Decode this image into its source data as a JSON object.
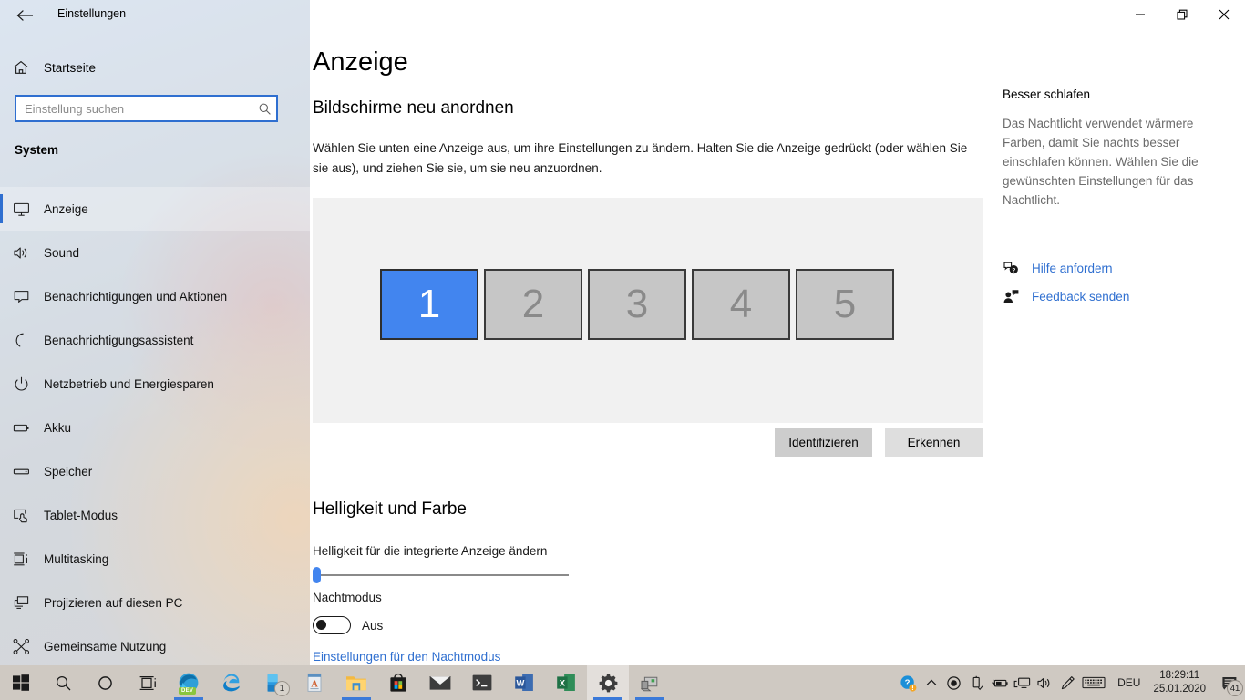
{
  "window": {
    "app_title": "Einstellungen",
    "back_icon": "back-arrow-icon",
    "minimize_label": "—",
    "maximize_label": "❐",
    "close_label": "✕"
  },
  "sidebar": {
    "home_label": "Startseite",
    "home_icon": "home-icon",
    "search": {
      "placeholder": "Einstellung suchen",
      "value": "",
      "icon": "search-icon"
    },
    "section_title": "System",
    "items": [
      {
        "label": "Anzeige",
        "icon": "monitor-icon",
        "selected": true
      },
      {
        "label": "Sound",
        "icon": "speaker-icon",
        "selected": false
      },
      {
        "label": "Benachrichtigungen und Aktionen",
        "icon": "chat-bubble-icon",
        "selected": false
      },
      {
        "label": "Benachrichtigungsassistent",
        "icon": "moon-icon",
        "selected": false
      },
      {
        "label": "Netzbetrieb und Energiesparen",
        "icon": "power-icon",
        "selected": false
      },
      {
        "label": "Akku",
        "icon": "battery-icon",
        "selected": false
      },
      {
        "label": "Speicher",
        "icon": "storage-icon",
        "selected": false
      },
      {
        "label": "Tablet-Modus",
        "icon": "tablet-hand-icon",
        "selected": false
      },
      {
        "label": "Multitasking",
        "icon": "multitasking-icon",
        "selected": false
      },
      {
        "label": "Projizieren auf diesen PC",
        "icon": "project-screen-icon",
        "selected": false
      },
      {
        "label": "Gemeinsame Nutzung",
        "icon": "share-icon",
        "selected": false
      }
    ]
  },
  "main": {
    "page_title": "Anzeige",
    "rearrange_heading": "Bildschirme neu anordnen",
    "rearrange_description": "Wählen Sie unten eine Anzeige aus, um ihre Einstellungen zu ändern. Halten Sie die Anzeige gedrückt (oder wählen Sie sie aus), und ziehen Sie sie, um sie neu anzuordnen.",
    "monitors": [
      {
        "number": "1",
        "selected": true
      },
      {
        "number": "2",
        "selected": false
      },
      {
        "number": "3",
        "selected": false
      },
      {
        "number": "4",
        "selected": false
      },
      {
        "number": "5",
        "selected": false
      }
    ],
    "identify_button": "Identifizieren",
    "detect_button": "Erkennen",
    "brightness_heading": "Helligkeit und Farbe",
    "brightness_label": "Helligkeit für die integrierte Anzeige ändern",
    "brightness_value": 0,
    "night_mode_label": "Nachtmodus",
    "night_mode_state": "Aus",
    "night_mode_on": false,
    "night_mode_link": "Einstellungen für den Nachtmodus"
  },
  "right_panel": {
    "title": "Besser schlafen",
    "body": "Das Nachtlicht verwendet wärmere Farben, damit Sie nachts besser einschlafen können. Wählen Sie die gewünschten Einstellungen für das Nachtlicht.",
    "links": [
      {
        "label": "Hilfe anfordern",
        "icon": "help-bubble-icon"
      },
      {
        "label": "Feedback senden",
        "icon": "feedback-person-icon"
      }
    ]
  },
  "taskbar": {
    "items": [
      {
        "name": "start-button",
        "icon": "windows-logo-icon"
      },
      {
        "name": "search-button",
        "icon": "search-icon"
      },
      {
        "name": "cortana-button",
        "icon": "cortana-circle-icon"
      },
      {
        "name": "task-view-button",
        "icon": "task-view-icon"
      },
      {
        "name": "edge-dev-button",
        "icon": "edge-dev-icon",
        "badge_text": "DEV",
        "running": true
      },
      {
        "name": "edge-legacy-button",
        "icon": "edge-legacy-icon"
      },
      {
        "name": "your-phone-button",
        "icon": "phone-icon",
        "badge": "1"
      },
      {
        "name": "wordpad-button",
        "icon": "wordpad-icon"
      },
      {
        "name": "file-explorer-button",
        "icon": "folder-icon",
        "running": true
      },
      {
        "name": "microsoft-store-button",
        "icon": "store-bag-icon"
      },
      {
        "name": "mail-button",
        "icon": "mail-envelope-icon"
      },
      {
        "name": "terminal-button",
        "icon": "command-prompt-icon"
      },
      {
        "name": "word-button",
        "icon": "word-icon"
      },
      {
        "name": "excel-button",
        "icon": "excel-icon"
      },
      {
        "name": "settings-button",
        "icon": "gear-icon",
        "running": true,
        "active": true
      },
      {
        "name": "remote-desktop-button",
        "icon": "remote-pc-icon",
        "running": true
      }
    ],
    "tray": {
      "icons": [
        {
          "name": "security-warning-icon",
          "glyph": "?"
        },
        {
          "name": "show-hidden-icons-chevron",
          "glyph": "∧"
        },
        {
          "name": "record-icon",
          "glyph": "◉"
        },
        {
          "name": "safely-remove-usb-icon",
          "glyph": "usb"
        },
        {
          "name": "battery-charging-icon",
          "glyph": "battery"
        },
        {
          "name": "network-icon",
          "glyph": "network"
        },
        {
          "name": "volume-icon",
          "glyph": "volume"
        },
        {
          "name": "pen-icon",
          "glyph": "pen"
        },
        {
          "name": "touch-keyboard-icon",
          "glyph": "keyboard"
        }
      ],
      "language": "DEU",
      "time": "18:29:11",
      "date": "25.01.2020",
      "notification_count": "41"
    }
  },
  "colors": {
    "accent": "#2f6fd0",
    "monitor_selected": "#4285ef",
    "taskbar": "#cfc9c2",
    "panel_bg": "#f1f1f1"
  }
}
